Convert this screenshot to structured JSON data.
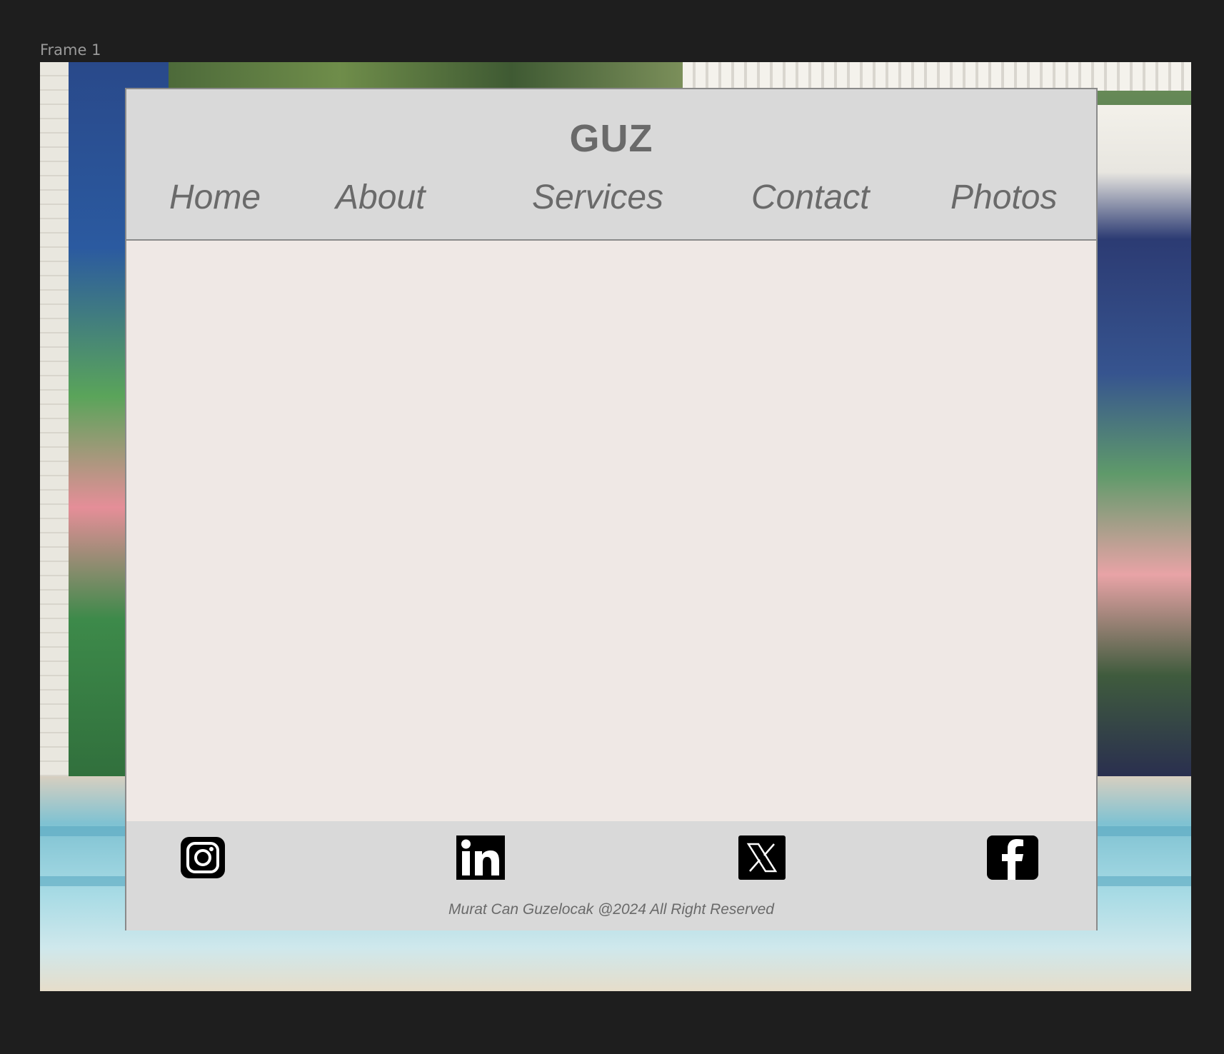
{
  "editor": {
    "frame_label": "Frame 1"
  },
  "site": {
    "brand": "GUZ",
    "nav": [
      {
        "label": "Home"
      },
      {
        "label": "About"
      },
      {
        "label": "Services"
      },
      {
        "label": "Contact"
      },
      {
        "label": "Photos"
      }
    ],
    "footer": {
      "social": [
        {
          "icon": "instagram-icon"
        },
        {
          "icon": "linkedin-icon"
        },
        {
          "icon": "x-icon"
        },
        {
          "icon": "facebook-icon"
        }
      ],
      "copyright": "Murat Can Guzelocak @2024 All Right Reserved"
    }
  },
  "colors": {
    "canvas_bg": "#1e1e1e",
    "header_bg": "#d9d9d9",
    "main_bg": "#efe8e5",
    "text": "#6a6a6a",
    "border": "#8a8a8a",
    "icon": "#000000"
  }
}
